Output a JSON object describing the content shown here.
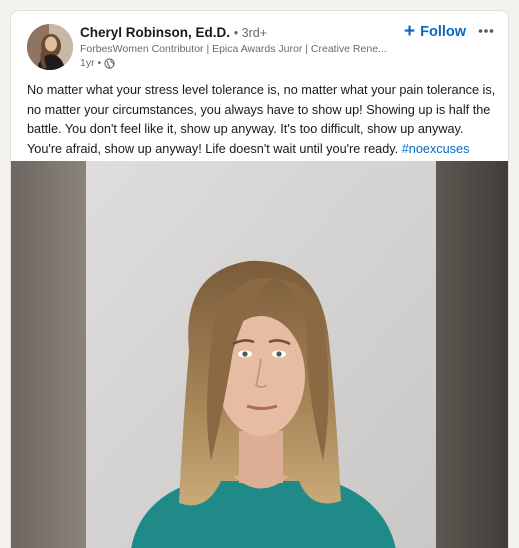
{
  "post": {
    "author_name": "Cheryl Robinson, Ed.D.",
    "connection_degree": "• 3rd+",
    "author_headline": "ForbesWomen Contributor | Epica Awards Juror | Creative Rene...",
    "post_age": "1yr •",
    "visibility_icon": "globe-icon",
    "follow_label": "Follow",
    "follow_icon": "plus-icon",
    "more_icon": "more-options-icon",
    "body_text": "No matter what your stress level tolerance is, no matter what your pain tolerance is, no matter your circumstances, you always have to show up! Showing up is half the battle. You don't feel like it, show up anyway. It's too difficult, show up anyway. You're afraid, show up anyway! Life doesn't wait until you're ready. ",
    "hashtag": "#noexcuses"
  },
  "colors": {
    "link": "#0a66c2",
    "background": "#f3f2ef",
    "card": "#ffffff"
  }
}
